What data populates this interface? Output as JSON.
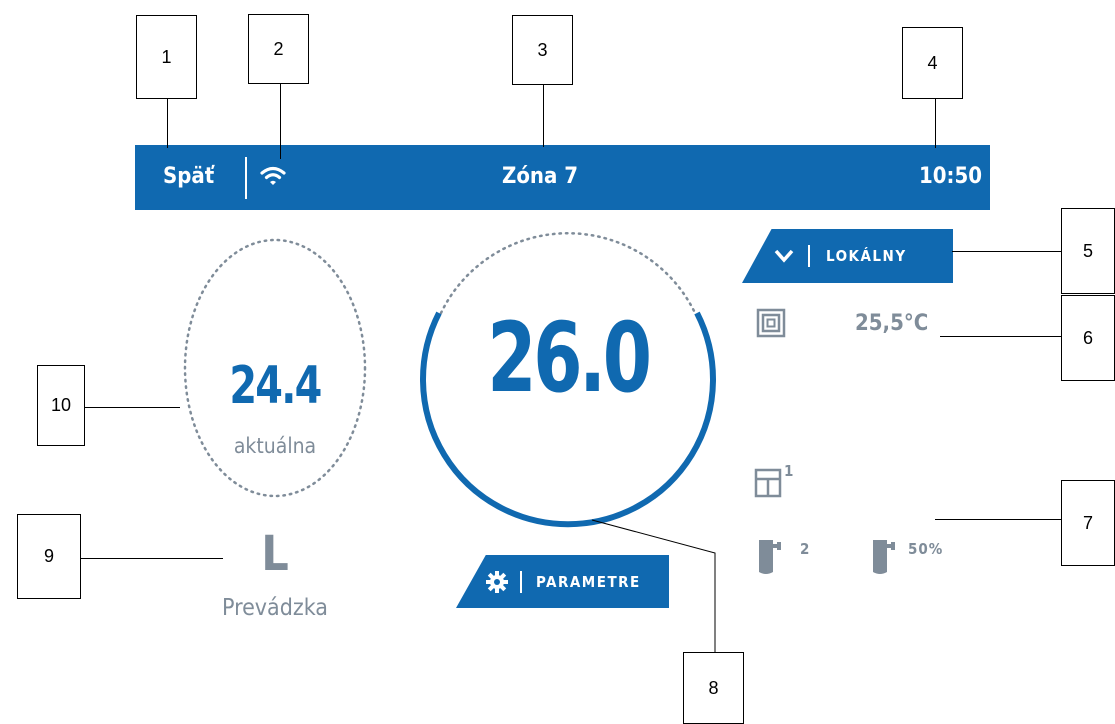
{
  "topbar": {
    "back_label": "Späť",
    "title": "Zóna 7",
    "time": "10:50"
  },
  "mode_pill": {
    "label": "LOKÁLNY",
    "icon": "chevron-down-icon"
  },
  "parameters_pill": {
    "label": "PARAMETRE",
    "icon": "gear-icon"
  },
  "setpoint": {
    "value": "26.0"
  },
  "current": {
    "value": "24.4",
    "label": "aktuálna"
  },
  "operation": {
    "value": "L",
    "label": "Prevádzka"
  },
  "floor": {
    "temperature": "25,5°C",
    "icon": "floor-heating-icon"
  },
  "devices": {
    "window_sensors": "1",
    "actuators": "2",
    "valve_opening": "50%"
  },
  "callouts": [
    "1",
    "2",
    "3",
    "4",
    "5",
    "6",
    "7",
    "8",
    "9",
    "10"
  ],
  "colors": {
    "accent": "#1069b0",
    "muted": "#7f8c99"
  }
}
